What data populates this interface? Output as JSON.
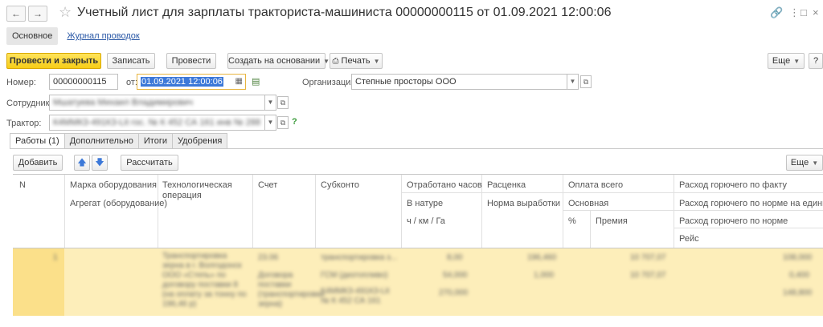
{
  "header": {
    "title": "Учетный лист для зарплаты тракториста-машиниста 00000000115 от 01.09.2021 12:00:06"
  },
  "top_tabs": [
    {
      "label": "Основное"
    },
    {
      "label": "Журнал проводок"
    }
  ],
  "toolbar": {
    "post_close": "Провести и закрыть",
    "save": "Записать",
    "post": "Провести",
    "create_based": "Создать на основании",
    "print": "Печать",
    "more": "Еще",
    "help": "?"
  },
  "form": {
    "number_label": "Номер:",
    "number_value": "00000000115",
    "date_label": "от:",
    "date_value": "01.09.2021 12:00:06",
    "org_label": "Организация:",
    "org_value": "Степные просторы ООО",
    "employee_label": "Сотрудник:",
    "employee_value": "Мшатуева Михаил Владимирович",
    "tractor_label": "Трактор:",
    "tractor_value": "К4ММКЗ-491КЗ-Lit гос. № К 452 СА 161   инв № 288"
  },
  "inner_tabs": [
    {
      "label": "Работы (1)"
    },
    {
      "label": "Дополнительно"
    },
    {
      "label": "Итоги"
    },
    {
      "label": "Удобрения"
    }
  ],
  "table_toolbar": {
    "add": "Добавить",
    "calculate": "Рассчитать",
    "more": "Еще"
  },
  "table": {
    "headers": {
      "n": "N",
      "equipment": "Марка оборудования",
      "unit": "Агрегат (оборудование)",
      "operation": "Технологическая операция",
      "account": "Счет",
      "subconto": "Субконто",
      "hours": "Отработано часов",
      "in_kind": "В натуре",
      "units": "ч / км / Га",
      "rate": "Расценка",
      "norm": "Норма выработки",
      "pay_total": "Оплата всего",
      "pay_basic": "Основная",
      "percent": "%",
      "bonus": "Премия",
      "fuel_actual": "Расход горючего по факту",
      "fuel_norm_unit": "Расход горючего по норме на единицу",
      "fuel_norm": "Расход горючего по норме",
      "trip": "Рейс"
    },
    "row": {
      "n": "1",
      "operation": "Транспортировка зерна в г. Волгодонск ООО «Степь» по договору поставки 8 (на оплату за тонну по 196,46 р)",
      "account": "23.06",
      "account2": "Договора поставки (транспортировки зерна)",
      "subconto1": "транспортировка з...",
      "subconto2": "ГСМ (дизтопливо)",
      "subconto3": "К4ММКЗ-491КЗ-Lit № К 452 СА 161",
      "hours": "8,00",
      "in_kind": "54,000",
      "units": "270,000",
      "rate": "196,460",
      "norm": "1,000",
      "pay_total": "10 707,07",
      "pay_basic": "10 707,07",
      "fuel_actual": "108,000",
      "fuel_norm_unit": "0,400",
      "fuel_norm": "148,800"
    }
  }
}
